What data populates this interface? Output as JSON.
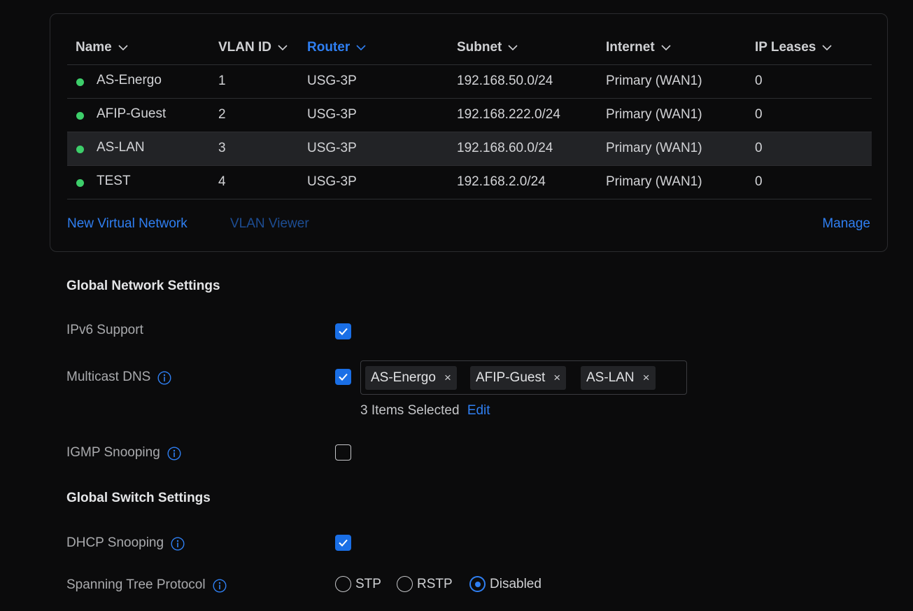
{
  "networks_table": {
    "columns": [
      {
        "label": "Name",
        "active": false
      },
      {
        "label": "VLAN ID",
        "active": false
      },
      {
        "label": "Router",
        "active": true
      },
      {
        "label": "Subnet",
        "active": false
      },
      {
        "label": "Internet",
        "active": false
      },
      {
        "label": "IP Leases",
        "active": false
      }
    ],
    "rows": [
      {
        "name": "AS-Energo",
        "vlan_id": "1",
        "router": "USG-3P",
        "subnet": "192.168.50.0/24",
        "internet": "Primary (WAN1)",
        "ip_leases": "0",
        "selected": false
      },
      {
        "name": "AFIP-Guest",
        "vlan_id": "2",
        "router": "USG-3P",
        "subnet": "192.168.222.0/24",
        "internet": "Primary (WAN1)",
        "ip_leases": "0",
        "selected": false
      },
      {
        "name": "AS-LAN",
        "vlan_id": "3",
        "router": "USG-3P",
        "subnet": "192.168.60.0/24",
        "internet": "Primary (WAN1)",
        "ip_leases": "0",
        "selected": true
      },
      {
        "name": "TEST",
        "vlan_id": "4",
        "router": "USG-3P",
        "subnet": "192.168.2.0/24",
        "internet": "Primary (WAN1)",
        "ip_leases": "0",
        "selected": false
      }
    ],
    "new_virtual_network": "New Virtual Network",
    "vlan_viewer": "VLAN Viewer",
    "manage": "Manage"
  },
  "global_network_settings": {
    "title": "Global Network Settings",
    "ipv6_support": {
      "label": "IPv6 Support",
      "checked": true
    },
    "multicast_dns": {
      "label": "Multicast DNS",
      "checked": true,
      "selected_networks": [
        "AS-Energo",
        "AFIP-Guest",
        "AS-LAN"
      ],
      "remove_glyph": "×",
      "items_selected": "3 Items Selected",
      "edit": "Edit"
    },
    "igmp_snooping": {
      "label": "IGMP Snooping",
      "checked": false
    }
  },
  "global_switch_settings": {
    "title": "Global Switch Settings",
    "dhcp_snooping": {
      "label": "DHCP Snooping",
      "checked": true
    },
    "spanning_tree_protocol": {
      "label": "Spanning Tree Protocol",
      "options": [
        "STP",
        "RSTP",
        "Disabled"
      ],
      "selected": "Disabled"
    }
  },
  "colors": {
    "accent": "#2f7ff2",
    "status_online": "#3dce6a",
    "background": "#0b0b0c"
  }
}
